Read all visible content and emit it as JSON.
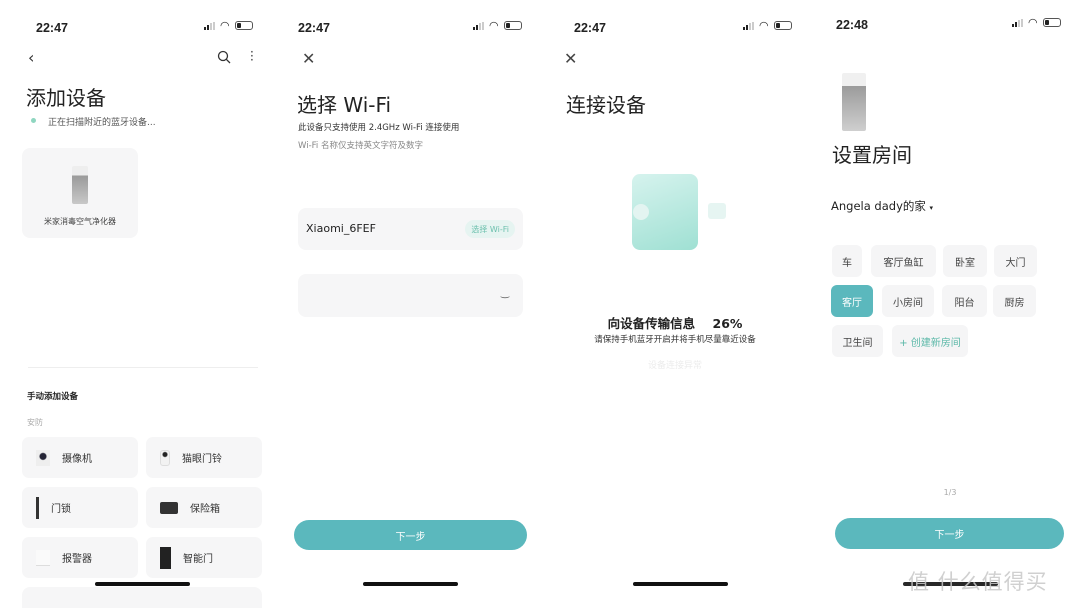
{
  "screen1": {
    "time": "22:47",
    "title": "添加设备",
    "scanning_text": "正在扫描附近的蓝牙设备...",
    "found_device": "米家消毒空气净化器",
    "manual_heading": "手动添加设备",
    "category": "安防",
    "devices": [
      "摄像机",
      "猫眼门铃",
      "门锁",
      "保险箱",
      "报警器",
      "智能门"
    ]
  },
  "screen2": {
    "time": "22:47",
    "title": "选择 Wi-Fi",
    "note1": "此设备只支持使用 2.4GHz Wi-Fi 连接使用",
    "note2": "Wi-Fi 名称仅支持英文字符及数字",
    "ssid": "Xiaomi_6FEF",
    "choose_wifi": "选择 Wi-Fi",
    "password_value": "",
    "next": "下一步"
  },
  "screen3": {
    "time": "22:47",
    "title": "连接设备",
    "progress_label": "向设备传输信息",
    "progress_percent": "26%",
    "hint": "请保持手机蓝牙开启并将手机尽量靠近设备",
    "faint_link": "设备连接异常"
  },
  "screen4": {
    "time": "22:48",
    "title": "设置房间",
    "home": "Angela dady的家",
    "rooms": [
      "车",
      "客厅鱼缸",
      "卧室",
      "大门",
      "客厅",
      "小房间",
      "阳台",
      "厨房",
      "卫生间"
    ],
    "selected_room": "客厅",
    "create_room": "+ 创建新房间",
    "page": "1/3",
    "next": "下一步"
  },
  "watermark": "值 什么值得买",
  "colors": {
    "accent": "#5bb8bd",
    "card": "#f6f6f7"
  }
}
